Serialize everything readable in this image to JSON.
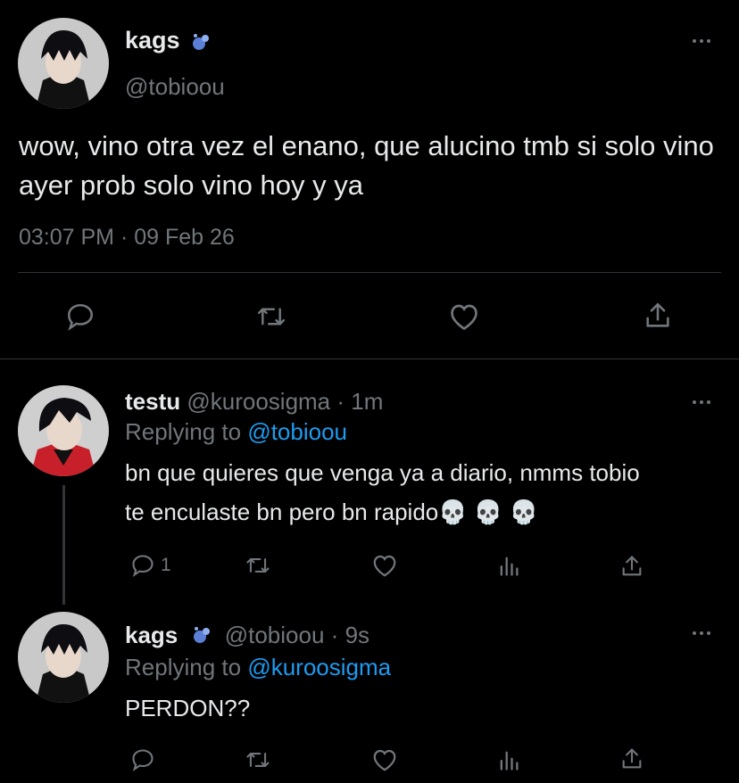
{
  "main_tweet": {
    "display_name": "kags",
    "handle": "@tobioou",
    "text": "wow, vino otra vez el enano, que alucino tmb si solo vino ayer prob solo vino hoy y ya",
    "time": "03:07 PM",
    "separator": "·",
    "date": "09 Feb 26"
  },
  "reply_1": {
    "display_name": "testu",
    "handle": "@kuroosigma",
    "separator": "·",
    "age": "1m",
    "replying_prefix": "Replying to",
    "replying_handle": "@tobioou",
    "text_line1": "bn que quieres que venga ya a diario, nmms tobio",
    "text_line2": "te enculaste bn pero bn rapido💀 💀 💀",
    "reply_count": "1"
  },
  "reply_2": {
    "display_name": "kags",
    "handle": "@tobioou",
    "separator": "·",
    "age": "9s",
    "replying_prefix": "Replying to",
    "replying_handle": "@kuroosigma",
    "text": "PERDON??"
  },
  "colors": {
    "background": "#000000",
    "text": "#e7e9ea",
    "muted": "#71767b",
    "link": "#1d9bf0",
    "divider": "#2f3336"
  },
  "icons": [
    "more-dots-icon",
    "reply-icon",
    "retweet-icon",
    "like-icon",
    "share-icon",
    "analytics-icon",
    "sparkle-emoji-icon"
  ]
}
